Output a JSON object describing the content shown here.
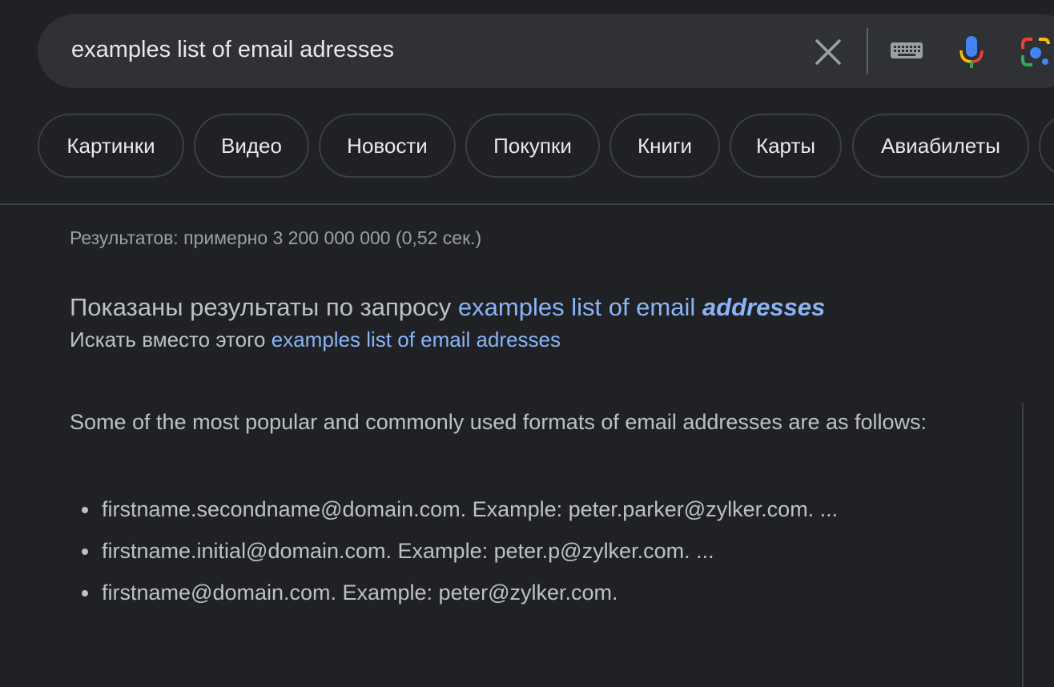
{
  "search": {
    "query": "examples list of email adresses"
  },
  "icons": {
    "clear": "close-icon",
    "keyboard": "keyboard-icon",
    "voice": "microphone-icon",
    "lens": "camera-lens-icon"
  },
  "chips": [
    {
      "label": "Картинки"
    },
    {
      "label": "Видео"
    },
    {
      "label": "Новости"
    },
    {
      "label": "Покупки"
    },
    {
      "label": "Книги"
    },
    {
      "label": "Карты"
    },
    {
      "label": "Авиабилеты"
    }
  ],
  "results_stats": "Результатов: примерно 3 200 000 000 (0,52 сек.)",
  "spelling": {
    "showing_prefix": "Показаны результаты по запросу",
    "corrected_query_plain": "examples list of email",
    "corrected_query_emph": "addresses",
    "instead_prefix": "Искать вместо этого",
    "original_query": "examples list of email adresses"
  },
  "snippet": {
    "intro": "Some of the most popular and commonly used formats of email addresses are as follows:",
    "items": [
      "firstname.secondname@domain.com. Example: peter.parker@zylker.com. ...",
      "firstname.initial@domain.com. Example: peter.p@zylker.com. ...",
      "firstname@domain.com. Example: peter@zylker.com."
    ]
  },
  "colors": {
    "background": "#202124",
    "search_bar": "#303134",
    "link": "#8ab4f8",
    "text": "#bdc1c6",
    "muted": "#9aa0a6"
  }
}
